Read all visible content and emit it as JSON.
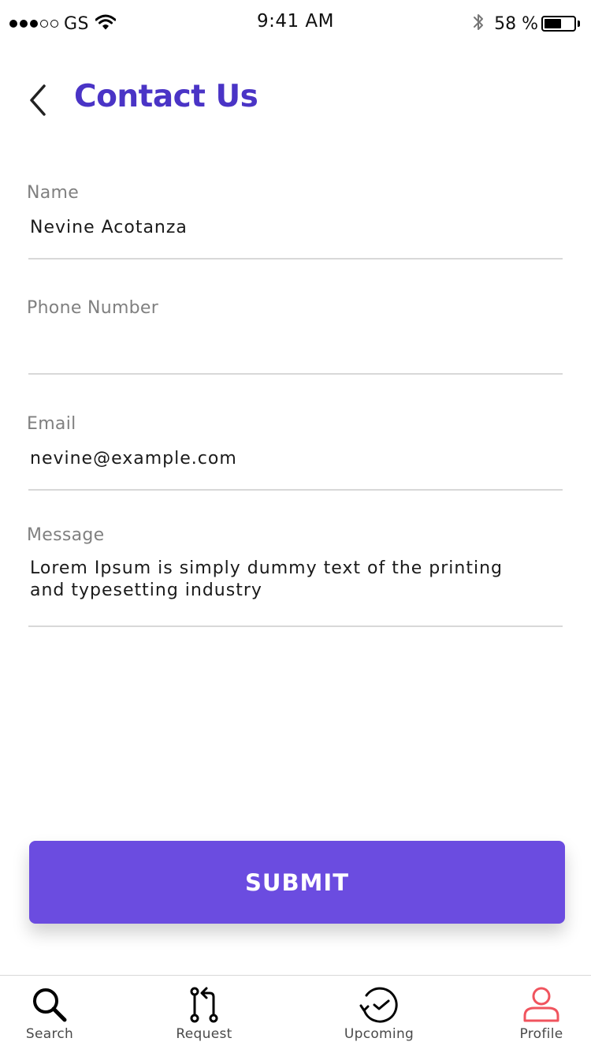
{
  "status_bar": {
    "carrier": "GS",
    "time": "9:41 AM",
    "battery_text": "58 %",
    "battery_level": 0.58
  },
  "header": {
    "title": "Contact Us",
    "back_icon": "chevron-left-icon"
  },
  "form": {
    "name_label": "Name",
    "name_value": "Nevine Acotanza",
    "phone_label": "Phone Number",
    "phone_value": "",
    "email_label": "Email",
    "email_value": "nevine@example.com",
    "message_label": "Message",
    "message_value": "Lorem Ipsum is simply dummy text of the printing and typesetting industry"
  },
  "submit_label": "SUBMIT",
  "tabs": [
    {
      "label": "Search",
      "icon": "search-icon"
    },
    {
      "label": "Request",
      "icon": "request-icon"
    },
    {
      "label": "Upcoming",
      "icon": "clock-icon"
    },
    {
      "label": "Profile",
      "icon": "user-icon"
    }
  ],
  "colors": {
    "accent": "#4a34c6",
    "button": "#6b4ce0",
    "active_tab": "#f0545e"
  }
}
